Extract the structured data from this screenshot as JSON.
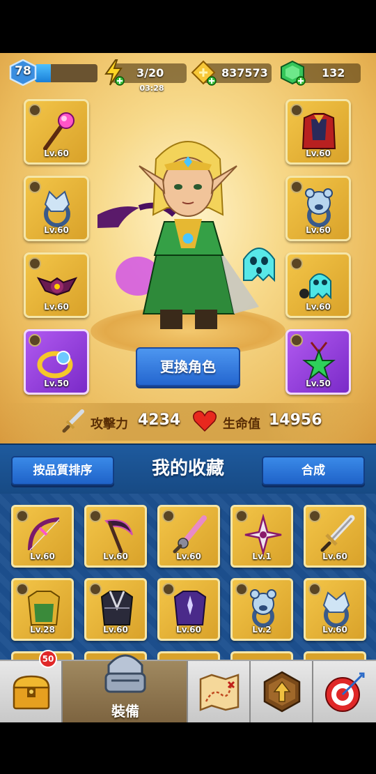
{
  "resources": {
    "level": "78",
    "xp_fraction": 0.25,
    "energy": "3/20",
    "energy_timer": "03:28",
    "gold": "837573",
    "gems": "132"
  },
  "equipment": {
    "left": [
      {
        "level": "Lv.60",
        "icon": "staff-icon"
      },
      {
        "level": "Lv.60",
        "icon": "wolf-ring-icon"
      },
      {
        "level": "Lv.60",
        "icon": "bat-pet-icon"
      },
      {
        "level": "Lv.50",
        "icon": "gold-ring-icon"
      }
    ],
    "right": [
      {
        "level": "Lv.60",
        "icon": "cape-armor-icon"
      },
      {
        "level": "Lv.60",
        "icon": "bear-ring-icon"
      },
      {
        "level": "Lv.60",
        "icon": "ghost-pet-icon"
      },
      {
        "level": "Lv.50",
        "icon": "star-amulet-icon"
      }
    ]
  },
  "hero": {
    "change_button": "更換角色"
  },
  "stats": {
    "attack_label": "攻擊力",
    "attack_value": "4234",
    "hp_label": "生命值",
    "hp_value": "14956"
  },
  "collection": {
    "sort_button": "按品質排序",
    "title": "我的收藏",
    "merge_button": "合成",
    "items": [
      {
        "level": "Lv.60",
        "icon": "bow-icon"
      },
      {
        "level": "Lv.60",
        "icon": "scythe-icon"
      },
      {
        "level": "Lv.60",
        "icon": "spiked-sword-icon"
      },
      {
        "level": "Lv.1",
        "icon": "shuriken-icon"
      },
      {
        "level": "Lv.60",
        "icon": "great-sword-icon"
      },
      {
        "level": "Lv.28",
        "icon": "gold-armor-icon"
      },
      {
        "level": "Lv.60",
        "icon": "dark-armor-icon"
      },
      {
        "level": "Lv.60",
        "icon": "purple-armor-icon"
      },
      {
        "level": "Lv.2",
        "icon": "bear-ring-icon"
      },
      {
        "level": "Lv.60",
        "icon": "wolf-ring-icon"
      }
    ]
  },
  "nav": {
    "chest_badge": "50",
    "equip_label": "裝備"
  },
  "colors": {
    "gold_card": "#d9a22a",
    "epic_card": "#7a2ac8",
    "blue_panel": "#1b4f8c",
    "button_blue": "#2466cf"
  }
}
